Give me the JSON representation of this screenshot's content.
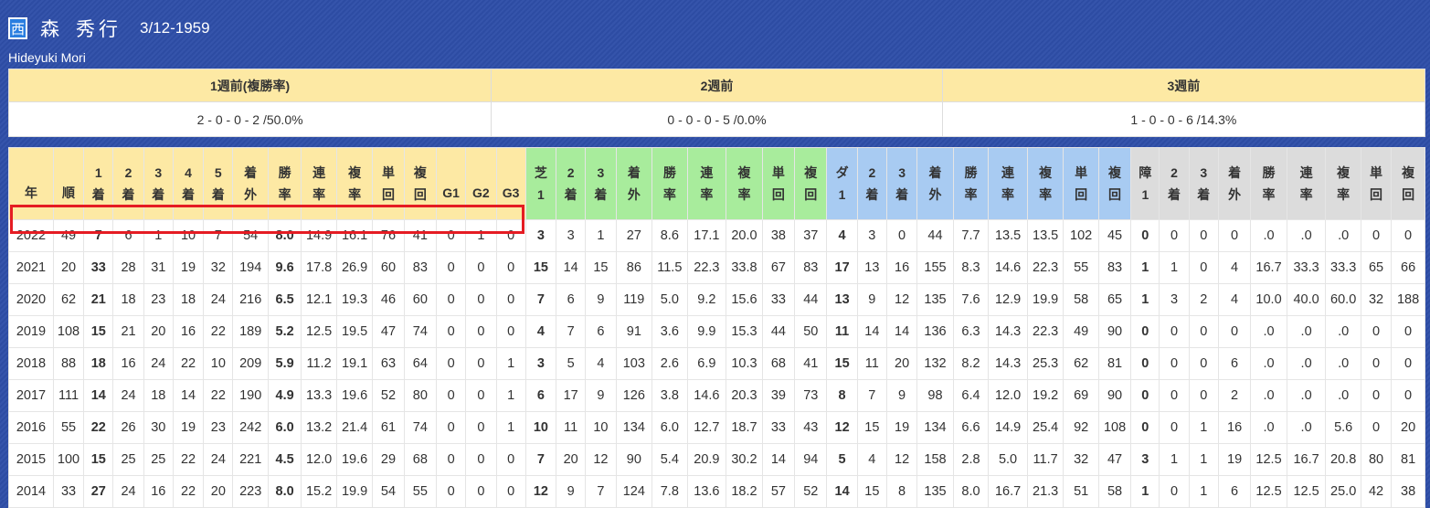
{
  "profile": {
    "affiliation": "西",
    "name_family": "森",
    "name_given": "秀行",
    "birthdate": "3/12-1959",
    "name_en": "Hideyuki Mori"
  },
  "weeks": [
    {
      "label": "1週前(複勝率)",
      "value": "2 - 0 - 0 - 2 /50.0%"
    },
    {
      "label": "2週前",
      "value": "0 - 0 - 0 - 5 /0.0%"
    },
    {
      "label": "3週前",
      "value": "1 - 0 - 0 - 6 /14.3%"
    }
  ],
  "stats": {
    "columns": [
      {
        "l1": "年",
        "l2": "",
        "c": "y"
      },
      {
        "l1": "順",
        "l2": "",
        "c": "y"
      },
      {
        "l1": "1",
        "l2": "着",
        "c": "y"
      },
      {
        "l1": "2",
        "l2": "着",
        "c": "y"
      },
      {
        "l1": "3",
        "l2": "着",
        "c": "y"
      },
      {
        "l1": "4",
        "l2": "着",
        "c": "y"
      },
      {
        "l1": "5",
        "l2": "着",
        "c": "y"
      },
      {
        "l1": "着",
        "l2": "外",
        "c": "y"
      },
      {
        "l1": "勝",
        "l2": "率",
        "c": "y"
      },
      {
        "l1": "連",
        "l2": "率",
        "c": "y"
      },
      {
        "l1": "複",
        "l2": "率",
        "c": "y"
      },
      {
        "l1": "単",
        "l2": "回",
        "c": "y"
      },
      {
        "l1": "複",
        "l2": "回",
        "c": "y"
      },
      {
        "l1": "G1",
        "l2": "",
        "c": "y"
      },
      {
        "l1": "G2",
        "l2": "",
        "c": "y"
      },
      {
        "l1": "G3",
        "l2": "",
        "c": "y"
      },
      {
        "l1": "芝",
        "l2": "1",
        "c": "g"
      },
      {
        "l1": "2",
        "l2": "着",
        "c": "g"
      },
      {
        "l1": "3",
        "l2": "着",
        "c": "g"
      },
      {
        "l1": "着",
        "l2": "外",
        "c": "g"
      },
      {
        "l1": "勝",
        "l2": "率",
        "c": "g"
      },
      {
        "l1": "連",
        "l2": "率",
        "c": "g"
      },
      {
        "l1": "複",
        "l2": "率",
        "c": "g"
      },
      {
        "l1": "単",
        "l2": "回",
        "c": "g"
      },
      {
        "l1": "複",
        "l2": "回",
        "c": "g"
      },
      {
        "l1": "ダ",
        "l2": "1",
        "c": "b"
      },
      {
        "l1": "2",
        "l2": "着",
        "c": "b"
      },
      {
        "l1": "3",
        "l2": "着",
        "c": "b"
      },
      {
        "l1": "着",
        "l2": "外",
        "c": "b"
      },
      {
        "l1": "勝",
        "l2": "率",
        "c": "b"
      },
      {
        "l1": "連",
        "l2": "率",
        "c": "b"
      },
      {
        "l1": "複",
        "l2": "率",
        "c": "b"
      },
      {
        "l1": "単",
        "l2": "回",
        "c": "b"
      },
      {
        "l1": "複",
        "l2": "回",
        "c": "b"
      },
      {
        "l1": "障",
        "l2": "1",
        "c": "gr"
      },
      {
        "l1": "2",
        "l2": "着",
        "c": "gr"
      },
      {
        "l1": "3",
        "l2": "着",
        "c": "gr"
      },
      {
        "l1": "着",
        "l2": "外",
        "c": "gr"
      },
      {
        "l1": "勝",
        "l2": "率",
        "c": "gr"
      },
      {
        "l1": "連",
        "l2": "率",
        "c": "gr"
      },
      {
        "l1": "複",
        "l2": "率",
        "c": "gr"
      },
      {
        "l1": "単",
        "l2": "回",
        "c": "gr"
      },
      {
        "l1": "複",
        "l2": "回",
        "c": "gr"
      }
    ],
    "bold_columns": [
      2,
      8,
      16,
      25,
      34
    ],
    "rows": [
      [
        "2022",
        "49",
        "7",
        "6",
        "1",
        "10",
        "7",
        "54",
        "8.0",
        "14.9",
        "16.1",
        "76",
        "41",
        "0",
        "1",
        "0",
        "3",
        "3",
        "1",
        "27",
        "8.6",
        "17.1",
        "20.0",
        "38",
        "37",
        "4",
        "3",
        "0",
        "44",
        "7.7",
        "13.5",
        "13.5",
        "102",
        "45",
        "0",
        "0",
        "0",
        "0",
        ".0",
        ".0",
        ".0",
        "0",
        "0"
      ],
      [
        "2021",
        "20",
        "33",
        "28",
        "31",
        "19",
        "32",
        "194",
        "9.6",
        "17.8",
        "26.9",
        "60",
        "83",
        "0",
        "0",
        "0",
        "15",
        "14",
        "15",
        "86",
        "11.5",
        "22.3",
        "33.8",
        "67",
        "83",
        "17",
        "13",
        "16",
        "155",
        "8.3",
        "14.6",
        "22.3",
        "55",
        "83",
        "1",
        "1",
        "0",
        "4",
        "16.7",
        "33.3",
        "33.3",
        "65",
        "66"
      ],
      [
        "2020",
        "62",
        "21",
        "18",
        "23",
        "18",
        "24",
        "216",
        "6.5",
        "12.1",
        "19.3",
        "46",
        "60",
        "0",
        "0",
        "0",
        "7",
        "6",
        "9",
        "119",
        "5.0",
        "9.2",
        "15.6",
        "33",
        "44",
        "13",
        "9",
        "12",
        "135",
        "7.6",
        "12.9",
        "19.9",
        "58",
        "65",
        "1",
        "3",
        "2",
        "4",
        "10.0",
        "40.0",
        "60.0",
        "32",
        "188"
      ],
      [
        "2019",
        "108",
        "15",
        "21",
        "20",
        "16",
        "22",
        "189",
        "5.2",
        "12.5",
        "19.5",
        "47",
        "74",
        "0",
        "0",
        "0",
        "4",
        "7",
        "6",
        "91",
        "3.6",
        "9.9",
        "15.3",
        "44",
        "50",
        "11",
        "14",
        "14",
        "136",
        "6.3",
        "14.3",
        "22.3",
        "49",
        "90",
        "0",
        "0",
        "0",
        "0",
        ".0",
        ".0",
        ".0",
        "0",
        "0"
      ],
      [
        "2018",
        "88",
        "18",
        "16",
        "24",
        "22",
        "10",
        "209",
        "5.9",
        "11.2",
        "19.1",
        "63",
        "64",
        "0",
        "0",
        "1",
        "3",
        "5",
        "4",
        "103",
        "2.6",
        "6.9",
        "10.3",
        "68",
        "41",
        "15",
        "11",
        "20",
        "132",
        "8.2",
        "14.3",
        "25.3",
        "62",
        "81",
        "0",
        "0",
        "0",
        "6",
        ".0",
        ".0",
        ".0",
        "0",
        "0"
      ],
      [
        "2017",
        "111",
        "14",
        "24",
        "18",
        "14",
        "22",
        "190",
        "4.9",
        "13.3",
        "19.6",
        "52",
        "80",
        "0",
        "0",
        "1",
        "6",
        "17",
        "9",
        "126",
        "3.8",
        "14.6",
        "20.3",
        "39",
        "73",
        "8",
        "7",
        "9",
        "98",
        "6.4",
        "12.0",
        "19.2",
        "69",
        "90",
        "0",
        "0",
        "0",
        "2",
        ".0",
        ".0",
        ".0",
        "0",
        "0"
      ],
      [
        "2016",
        "55",
        "22",
        "26",
        "30",
        "19",
        "23",
        "242",
        "6.0",
        "13.2",
        "21.4",
        "61",
        "74",
        "0",
        "0",
        "1",
        "10",
        "11",
        "10",
        "134",
        "6.0",
        "12.7",
        "18.7",
        "33",
        "43",
        "12",
        "15",
        "19",
        "134",
        "6.6",
        "14.9",
        "25.4",
        "92",
        "108",
        "0",
        "0",
        "1",
        "16",
        ".0",
        ".0",
        "5.6",
        "0",
        "20"
      ],
      [
        "2015",
        "100",
        "15",
        "25",
        "25",
        "22",
        "24",
        "221",
        "4.5",
        "12.0",
        "19.6",
        "29",
        "68",
        "0",
        "0",
        "0",
        "7",
        "20",
        "12",
        "90",
        "5.4",
        "20.9",
        "30.2",
        "14",
        "94",
        "5",
        "4",
        "12",
        "158",
        "2.8",
        "5.0",
        "11.7",
        "32",
        "47",
        "3",
        "1",
        "1",
        "19",
        "12.5",
        "16.7",
        "20.8",
        "80",
        "81"
      ],
      [
        "2014",
        "33",
        "27",
        "24",
        "16",
        "22",
        "20",
        "223",
        "8.0",
        "15.2",
        "19.9",
        "54",
        "55",
        "0",
        "0",
        "0",
        "12",
        "9",
        "7",
        "124",
        "7.8",
        "13.6",
        "18.2",
        "57",
        "52",
        "14",
        "15",
        "8",
        "135",
        "8.0",
        "16.7",
        "21.3",
        "51",
        "58",
        "1",
        "0",
        "1",
        "6",
        "12.5",
        "12.5",
        "25.0",
        "42",
        "38"
      ]
    ]
  }
}
